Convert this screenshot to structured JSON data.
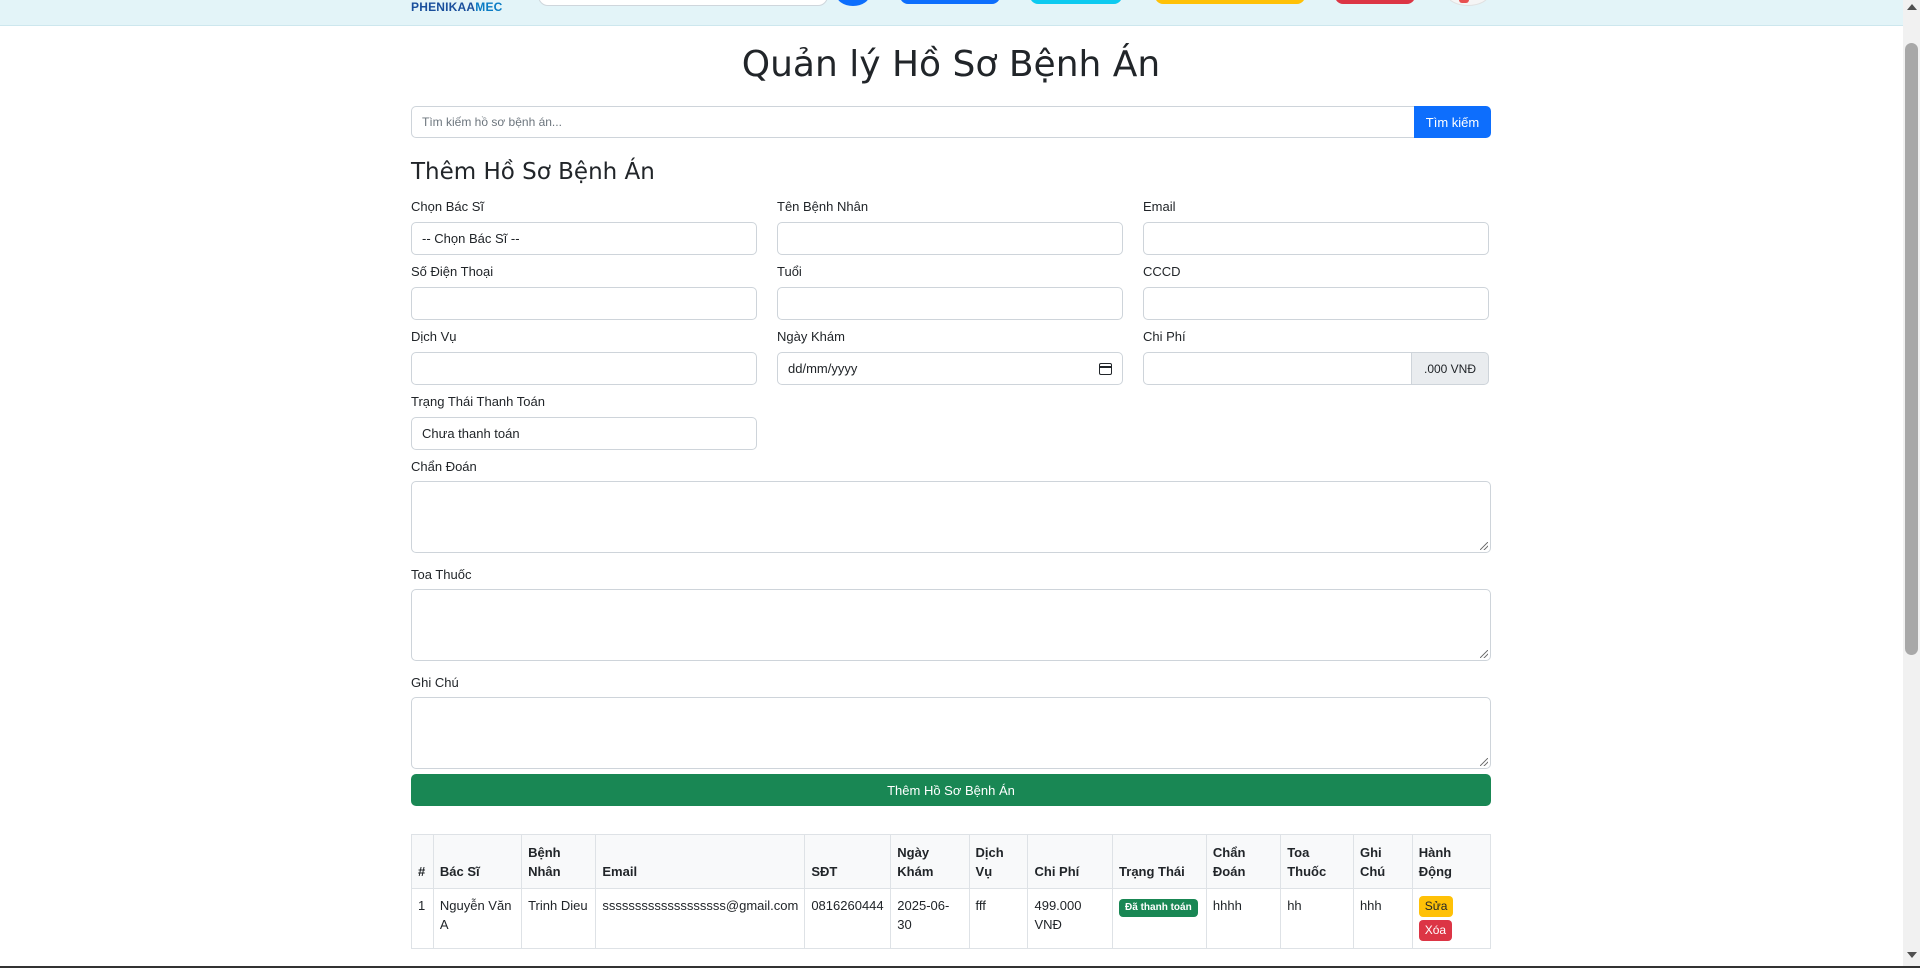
{
  "nav": {
    "logo_primary": "PHENIKAA",
    "logo_accent": "MEC"
  },
  "page": {
    "title": "Quản lý Hồ Sơ Bệnh Án"
  },
  "search": {
    "placeholder": "Tìm kiếm hồ sơ bệnh án...",
    "button_label": "Tìm kiếm"
  },
  "form": {
    "title": "Thêm Hồ Sơ Bệnh Án",
    "fields": {
      "doctor": {
        "label": "Chọn Bác Sĩ",
        "value": "-- Chọn Bác Sĩ --"
      },
      "patient_name": {
        "label": "Tên Bệnh Nhân",
        "value": ""
      },
      "email": {
        "label": "Email",
        "value": ""
      },
      "phone": {
        "label": "Số Điện Thoại",
        "value": ""
      },
      "age": {
        "label": "Tuổi",
        "value": ""
      },
      "cccd": {
        "label": "CCCD",
        "value": ""
      },
      "service": {
        "label": "Dịch Vụ",
        "value": ""
      },
      "exam_date": {
        "label": "Ngày Khám",
        "value": "dd/mm/yyyy"
      },
      "cost": {
        "label": "Chi Phí",
        "value": "",
        "suffix": ".000 VNĐ"
      },
      "payment_status": {
        "label": "Trạng Thái Thanh Toán",
        "value": "Chưa thanh toán"
      },
      "diagnosis": {
        "label": "Chẩn Đoán",
        "value": ""
      },
      "prescription": {
        "label": "Toa Thuốc",
        "value": ""
      },
      "notes": {
        "label": "Ghi Chú",
        "value": ""
      }
    },
    "submit_label": "Thêm Hồ Sơ Bệnh Án"
  },
  "table": {
    "headers": {
      "index": "#",
      "doctor": "Bác Sĩ",
      "patient": "Bệnh Nhân",
      "email": "Email",
      "phone": "SĐT",
      "date": "Ngày Khám",
      "service": "Dịch Vụ",
      "cost": "Chi Phí",
      "status": "Trạng Thái",
      "diagnosis": "Chẩn Đoán",
      "prescription": "Toa Thuốc",
      "notes": "Ghi Chú",
      "actions": "Hành Động"
    },
    "rows": [
      {
        "index": "1",
        "doctor": "Nguyễn Văn A",
        "patient": "Trinh Dieu",
        "email": "sssssssssssssssssss@gmail.com",
        "phone": "0816260444",
        "date": "2025-06-30",
        "service": "fff",
        "cost": "499.000 VNĐ",
        "status": "Đã thanh toán",
        "diagnosis": "hhhh",
        "prescription": "hh",
        "notes": "hhh",
        "edit_label": "Sửa",
        "delete_label": "Xóa"
      }
    ]
  },
  "colors": {
    "primary": "#0d6efd",
    "success": "#198754",
    "warning": "#ffc107",
    "danger": "#dc3545",
    "nav_bg": "#e3f4f8"
  }
}
